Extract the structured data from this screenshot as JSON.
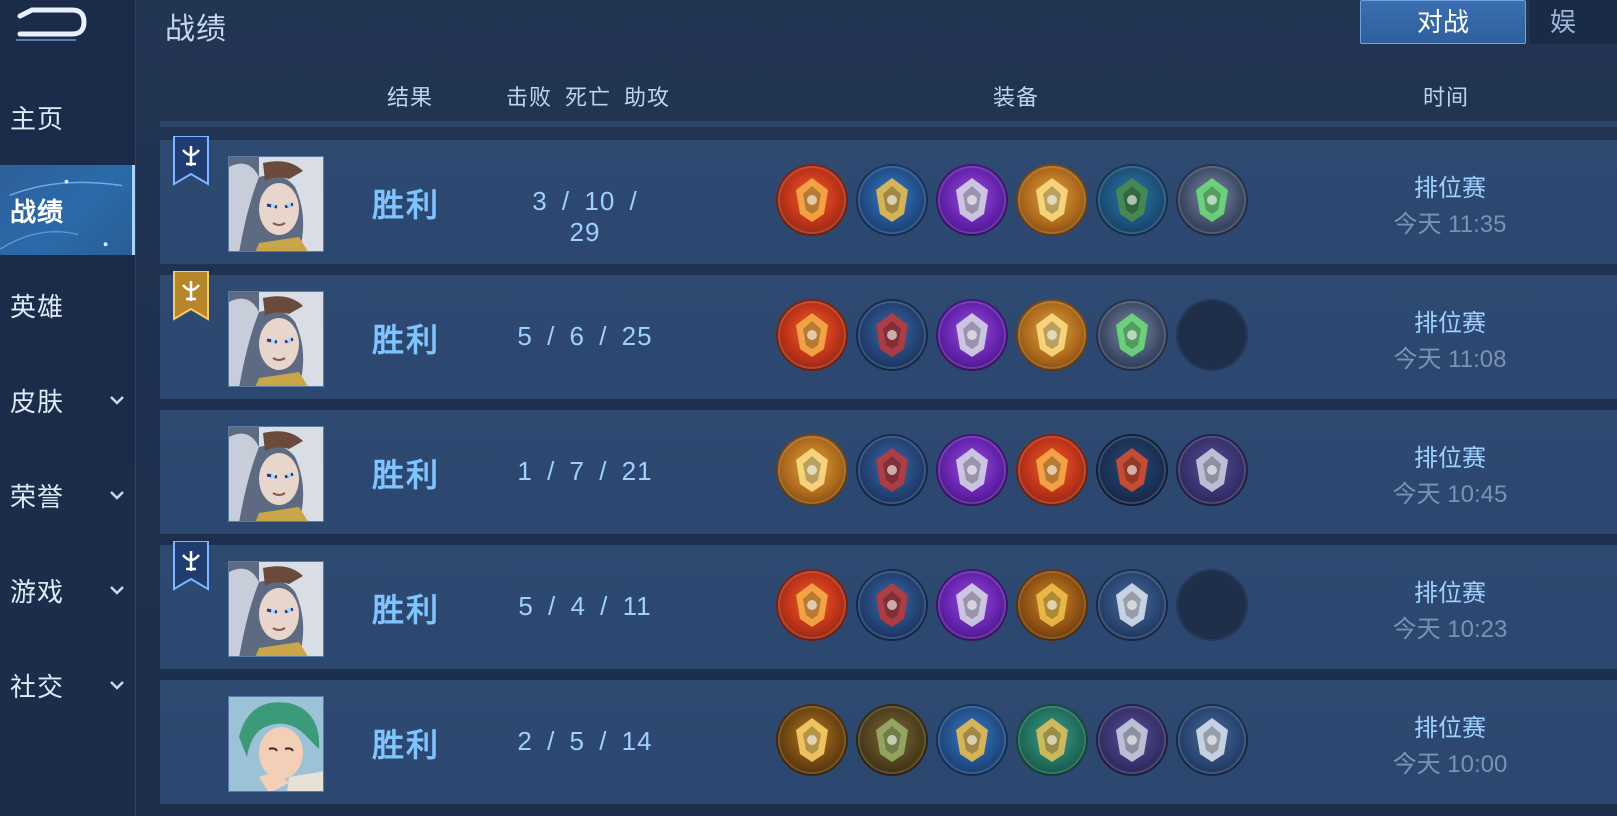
{
  "page": {
    "title": "战绩"
  },
  "tabs": {
    "active": "对战",
    "next": "娱"
  },
  "sidebar": {
    "items": [
      {
        "label": "主页",
        "has_chevron": false,
        "active": false
      },
      {
        "label": "战绩",
        "has_chevron": false,
        "active": true
      },
      {
        "label": "英雄",
        "has_chevron": false,
        "active": false
      },
      {
        "label": "皮肤",
        "has_chevron": true,
        "active": false
      },
      {
        "label": "荣誉",
        "has_chevron": true,
        "active": false
      },
      {
        "label": "游戏",
        "has_chevron": true,
        "active": false
      },
      {
        "label": "社交",
        "has_chevron": true,
        "active": false
      }
    ]
  },
  "columns": {
    "result": "结果",
    "kills": "击败",
    "deaths": "死亡",
    "assists": "助攻",
    "equipment": "装备",
    "time": "时间"
  },
  "matches": [
    {
      "badge": "blue",
      "hero": "silver-haired-hero",
      "result": "胜利",
      "kda": "3 / 10 / 29",
      "items": [
        "red-amulet",
        "blue-crest",
        "purple-gauntlet",
        "gold-crest",
        "green-boots",
        "silver-gem"
      ],
      "mode": "排位赛",
      "time": "今天 11:35"
    },
    {
      "badge": "gold",
      "hero": "silver-haired-hero",
      "result": "胜利",
      "kda": "5 / 6 / 25",
      "items": [
        "red-amulet",
        "red-boots",
        "purple-gauntlet",
        "gold-crest",
        "silver-gem",
        "empty"
      ],
      "mode": "排位赛",
      "time": "今天 11:08"
    },
    {
      "badge": "none",
      "hero": "silver-haired-hero",
      "result": "胜利",
      "kda": "1 / 7 / 21",
      "items": [
        "gold-crest",
        "red-boots",
        "purple-gauntlet",
        "red-amulet",
        "red-crystal",
        "silver-armor"
      ],
      "mode": "排位赛",
      "time": "今天 10:45"
    },
    {
      "badge": "blue",
      "hero": "silver-haired-hero",
      "result": "胜利",
      "kda": "5 / 4 / 11",
      "items": [
        "red-amulet",
        "red-boots",
        "purple-gauntlet",
        "gold-ring",
        "steel-bracer",
        "empty"
      ],
      "mode": "排位赛",
      "time": "今天 10:23"
    },
    {
      "badge": "none",
      "hero": "green-haired-hero",
      "result": "胜利",
      "kda": "2 / 5 / 14",
      "items": [
        "gold-dagger",
        "olive-boots",
        "blue-crest",
        "green-rune",
        "silver-armor",
        "steel-bracer"
      ],
      "mode": "排位赛",
      "time": "今天 10:00"
    }
  ]
}
